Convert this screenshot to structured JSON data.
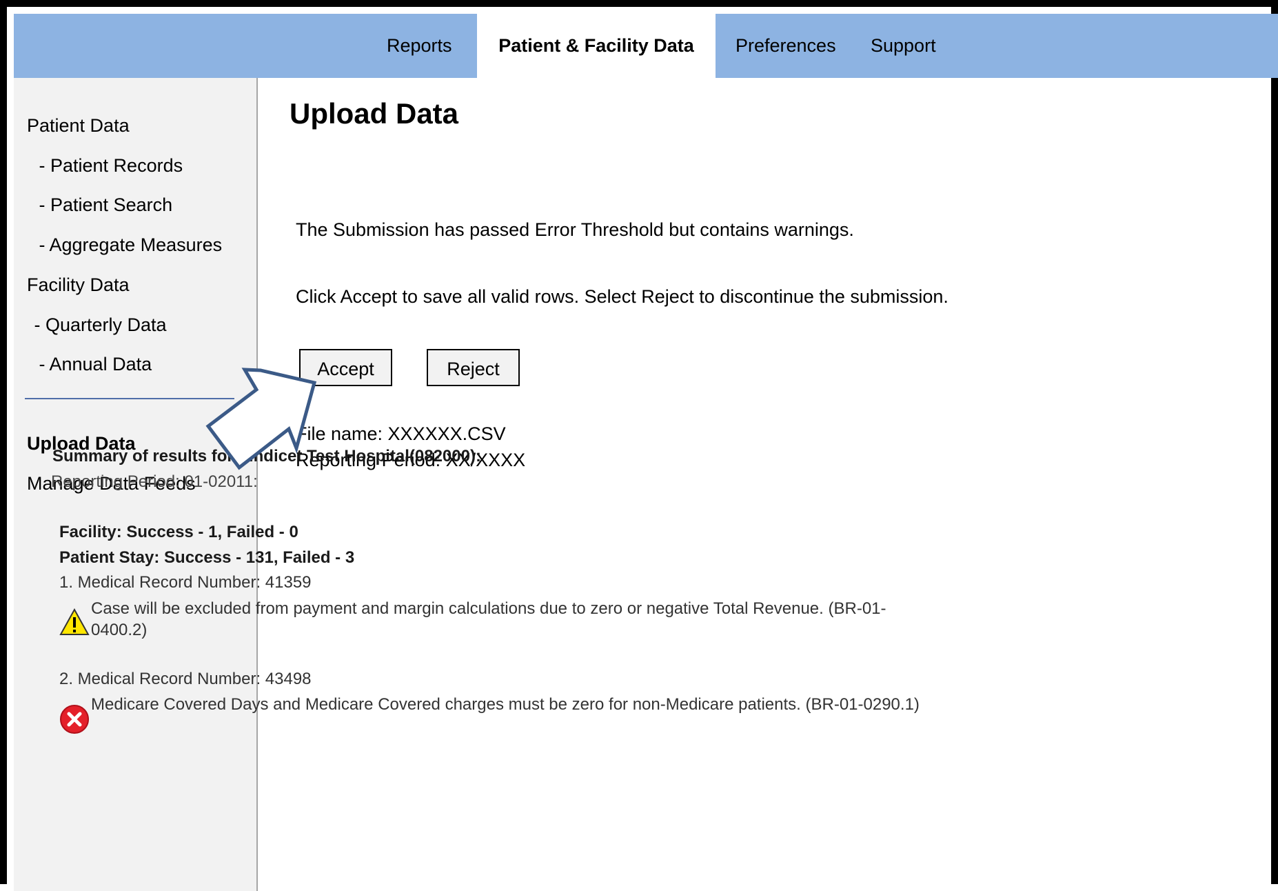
{
  "nav": {
    "tabs": [
      {
        "label": "Reports"
      },
      {
        "label": "Patient & Facility Data"
      },
      {
        "label": "Preferences"
      },
      {
        "label": "Support"
      }
    ]
  },
  "sidebar": {
    "items": [
      {
        "label": "Patient Data"
      },
      {
        "label": " - Patient Records"
      },
      {
        "label": " - Patient Search"
      },
      {
        "label": " - Aggregate Measures"
      },
      {
        "label": "Facility Data"
      },
      {
        "label": " - Quarterly Data"
      },
      {
        "label": " - Annual Data"
      },
      {
        "label": "Upload Data"
      },
      {
        "label": "Manage Data Feeds"
      }
    ]
  },
  "main": {
    "title": "Upload Data",
    "message1": "The Submission has  passed Error Threshold but contains warnings.",
    "message2": "Click Accept to save all valid rows. Select Reject to discontinue the submission.",
    "accept_label": "Accept",
    "reject_label": "Reject",
    "file_name": "File name: XXXXXX.CSV",
    "reporting_period": "Reporting Period: XX/XXXX"
  },
  "summary": {
    "title": "Summary of results for Vindicet Test Hospital(082000):",
    "period": "Reporting Period: 01-02011:",
    "facility": "Facility: Success - 1, Failed - 0",
    "patient_stay": "Patient Stay: Success - 131, Failed - 3",
    "record1": "1. Medical Record Number: 41359",
    "issue1": "Case will be excluded from payment and margin calculations due to zero or negative Total Revenue. (BR-01-0400.2)",
    "record2": "2. Medical Record Number: 43498",
    "issue2": "Medicare Covered Days and Medicare Covered charges must be zero for non-Medicare patients. (BR-01-0290.1)"
  },
  "colors": {
    "topbar": "#8db3e2",
    "sidebar": "#f2f2f2",
    "arrow_stroke": "#3b5a87",
    "warning": "#ffe600",
    "error": "#e4202a"
  },
  "icons": [
    "warning-icon",
    "error-icon",
    "pointer-arrow"
  ]
}
